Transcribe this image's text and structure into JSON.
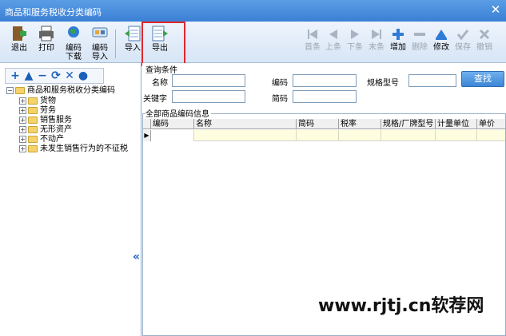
{
  "window": {
    "title": "商品和服务税收分类编码",
    "close_glyph": "✕"
  },
  "toolbar": {
    "exit": "退出",
    "print": "打印",
    "download": [
      "编码",
      "下载"
    ],
    "import_code": [
      "编码",
      "导入"
    ],
    "import": "导入",
    "export": "导出",
    "first": "首条",
    "prev": "上条",
    "next": "下条",
    "last": "末条",
    "add": "增加",
    "delete": "删除",
    "modify": "修改",
    "save": "保存",
    "cancel": "撤销"
  },
  "tree": {
    "root": "商品和服务税收分类编码",
    "items": [
      "货物",
      "劳务",
      "销售服务",
      "无形资产",
      "不动产",
      "未发生销售行为的不征税"
    ]
  },
  "query": {
    "group_title": "查询条件",
    "name_label": "名称",
    "code_label": "编码",
    "spec_label": "规格型号",
    "keyword_label": "关键字",
    "shortcode_label": "简码",
    "search_button": "查找"
  },
  "grid": {
    "group_title": "全部商品编码信息",
    "columns": [
      "编码",
      "名称",
      "简码",
      "税率",
      "规格/厂牌型号",
      "计量单位",
      "单价"
    ],
    "row_indicator": "▶"
  },
  "watermark": "www.rjtj.cn软荐网",
  "colors": {
    "accent": "#3a7fd4",
    "highlight": "#e0282d",
    "row": "#fffde0"
  }
}
